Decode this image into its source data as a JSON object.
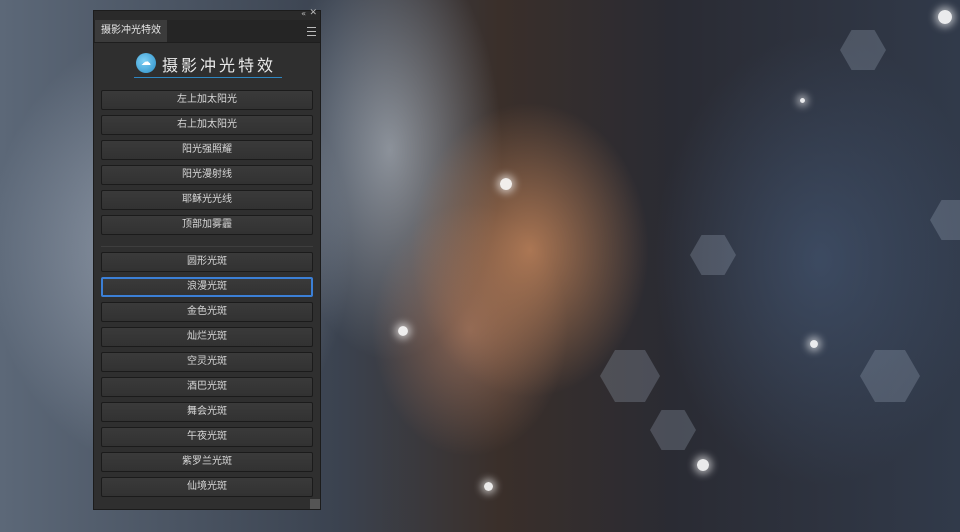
{
  "panel": {
    "tab_label": "摄影冲光特效",
    "collapse_glyph": "«",
    "close_glyph": "✕",
    "title": "摄影冲光特效",
    "logo_glyph": "☁"
  },
  "group1": [
    {
      "label": "左上加太阳光"
    },
    {
      "label": "右上加太阳光"
    },
    {
      "label": "阳光强照耀"
    },
    {
      "label": "阳光漫射线"
    },
    {
      "label": "耶稣光光线"
    },
    {
      "label": "顶部加雾霾"
    }
  ],
  "group2": [
    {
      "label": "圆形光斑"
    },
    {
      "label": "浪漫光斑",
      "active": true
    },
    {
      "label": "金色光斑"
    },
    {
      "label": "灿烂光斑"
    },
    {
      "label": "空灵光斑"
    },
    {
      "label": "酒巴光斑"
    },
    {
      "label": "舞会光斑"
    },
    {
      "label": "午夜光斑"
    },
    {
      "label": "紫罗兰光斑"
    },
    {
      "label": "仙境光斑"
    }
  ]
}
